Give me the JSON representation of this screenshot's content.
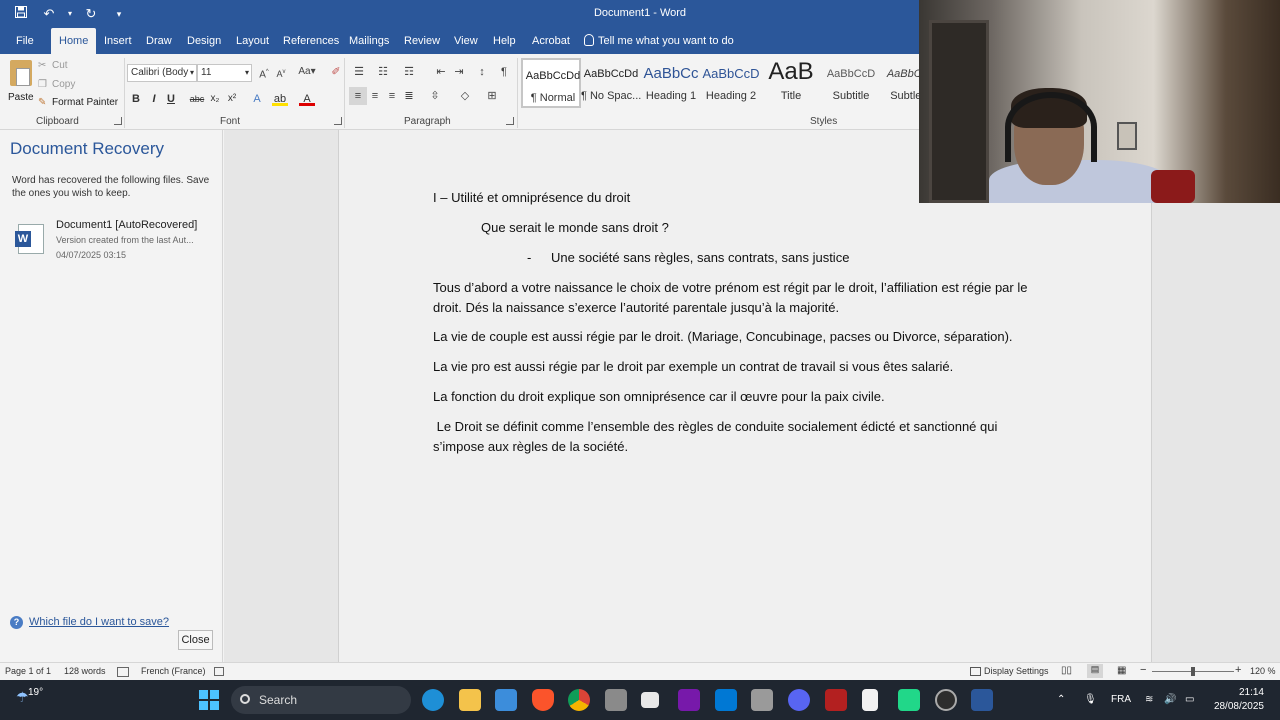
{
  "window": {
    "title": "Document1 - Word"
  },
  "tabs": [
    "File",
    "Home",
    "Insert",
    "Draw",
    "Design",
    "Layout",
    "References",
    "Mailings",
    "Review",
    "View",
    "Help",
    "Acrobat"
  ],
  "tell_me": "Tell me what you want to do",
  "ribbon": {
    "clipboard": {
      "paste": "Paste",
      "cut": "Cut",
      "copy": "Copy",
      "format_painter": "Format Painter",
      "label": "Clipboard"
    },
    "font": {
      "name": "Calibri (Body",
      "size": "11",
      "label": "Font"
    },
    "paragraph": {
      "label": "Paragraph"
    },
    "styles": {
      "label": "Styles",
      "items": [
        {
          "sample": "AaBbCcDd",
          "name": "¶ Normal"
        },
        {
          "sample": "AaBbCcDd",
          "name": "¶ No Spac..."
        },
        {
          "sample": "AaBbCc",
          "name": "Heading 1"
        },
        {
          "sample": "AaBbCcD",
          "name": "Heading 2"
        },
        {
          "sample": "AaB",
          "name": "Title"
        },
        {
          "sample": "AaBbCcD",
          "name": "Subtitle"
        },
        {
          "sample": "AaBbCcD",
          "name": "Subtle E"
        }
      ]
    }
  },
  "recovery": {
    "title": "Document Recovery",
    "description": "Word has recovered the following files. Save the ones you wish to keep.",
    "file": {
      "name": "Document1  [AutoRecovered]",
      "version": "Version created from the last Aut...",
      "date": "04/07/2025 03:15"
    },
    "help_link": "Which file do I want to save?",
    "close": "Close"
  },
  "document": {
    "paragraphs": [
      "I – Utilité et omniprésence du droit",
      "Que serait le monde sans droit ?",
      "-",
      "Une société sans règles, sans contrats, sans justice",
      "Tous d’abord a votre naissance le choix de votre prénom est régit par le droit, l’affiliation est régie par le",
      "droit. Dés la naissance s’exerce l’autorité parentale jusqu’à la majorité.",
      "La vie de couple est aussi régie par le droit. (Mariage, Concubinage, pacses ou Divorce, séparation).",
      "La vie pro est aussi régie par le droit par exemple un contrat de travail si vous êtes salarié.",
      "La fonction du droit explique son omniprésence car il œuvre pour la paix civile.",
      " Le Droit se définit comme l’ensemble des règles de conduite socialement édicté et sanctionné qui",
      "s’impose aux règles de la société."
    ]
  },
  "status": {
    "page": "Page 1 of 1",
    "words": "128 words",
    "language": "French (France)",
    "display_settings": "Display Settings",
    "zoom": "120 %"
  },
  "taskbar": {
    "weather": "19°",
    "search": "Search",
    "lang": "FRA",
    "time": "21:14",
    "date": "28/08/2025"
  },
  "colors": {
    "word_blue": "#2b579a",
    "taskbar": "#1f2630"
  }
}
